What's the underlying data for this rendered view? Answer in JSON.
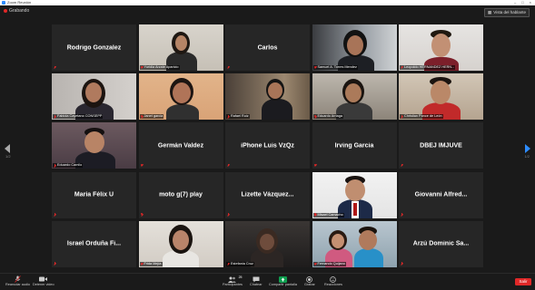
{
  "window": {
    "title": "Zoom Reunión"
  },
  "topbar": {
    "recording_label": "Grabando",
    "speaker_view_label": "Vista del hablante"
  },
  "pagination": {
    "left": "1/2",
    "right": "1/2"
  },
  "tiles": [
    {
      "name": "Rodrigo Gonzalez",
      "type": "name"
    },
    {
      "label": "Yuridia Arzate Aparicio",
      "type": "video"
    },
    {
      "name": "Carlos",
      "type": "name"
    },
    {
      "label": "Samuel A. Torres Mendez",
      "type": "video"
    },
    {
      "label": "Leopoldo HERNANDEZ HERN...",
      "type": "video"
    },
    {
      "label": "Fabiola Cayetano CONSEPP",
      "type": "video"
    },
    {
      "label": "Janet garcia",
      "type": "video",
      "active": true
    },
    {
      "label": "Rafael Ruiz",
      "type": "video"
    },
    {
      "label": "Eduardo Arriaga",
      "type": "video"
    },
    {
      "label": "Christian Ponce de León",
      "type": "video"
    },
    {
      "label": "Eduardo Camilo",
      "type": "video"
    },
    {
      "name": "Germán Valdez",
      "type": "name"
    },
    {
      "name": "iPhone Luis VzQz",
      "type": "name"
    },
    {
      "name": "Irving Garcia",
      "type": "name"
    },
    {
      "name": "DBEJ IMJUVE",
      "type": "name"
    },
    {
      "name": "María Félix U",
      "type": "name"
    },
    {
      "name": "moto g(7) play",
      "type": "name"
    },
    {
      "name": "Lizette Vázquez...",
      "type": "name"
    },
    {
      "label": "Misael Camacho",
      "type": "video"
    },
    {
      "name": "Giovanni Alfred...",
      "type": "name"
    },
    {
      "name": "Israel Orduña Fi...",
      "type": "name"
    },
    {
      "label": "Frida Mejía",
      "type": "video"
    },
    {
      "label": "Estefania Cruz",
      "type": "video"
    },
    {
      "label": "Fernando Quijano",
      "type": "video"
    },
    {
      "name": "Arzú Dominic Sa...",
      "type": "name"
    }
  ],
  "toolbar": {
    "unmute": "Reanudar audio",
    "start_video": "Detener video",
    "participants": "Participantes",
    "participants_count": "25",
    "chat": "Chatear",
    "share": "Compartir pantalla",
    "record": "Grabar",
    "reactions": "Reacciones",
    "leave": "Salir"
  },
  "colors": {
    "accent": "#2d8cff",
    "leave": "#e02828",
    "share": "#0e9f4f",
    "active_speaker": "#e8c74a"
  }
}
